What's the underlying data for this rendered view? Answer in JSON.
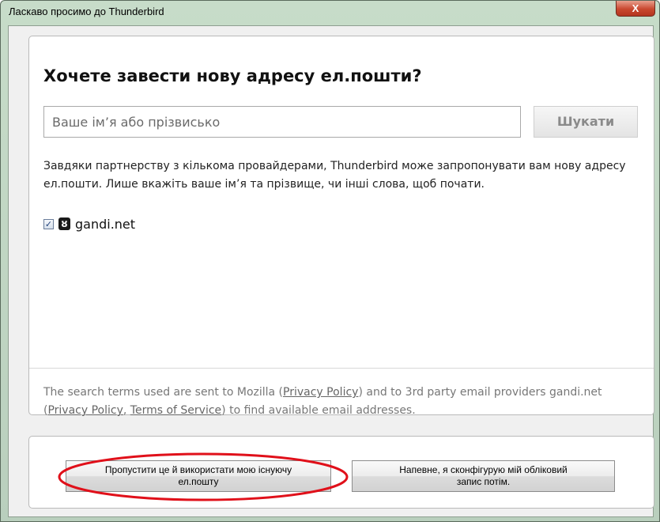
{
  "window": {
    "title": "Ласкаво просимо до Thunderbird",
    "close_label": "X"
  },
  "main": {
    "heading": "Хочете завести нову адресу ел.пошти?",
    "search": {
      "placeholder": "Ваше ім’я або прізвисько",
      "value": "",
      "button_label": "Шукати"
    },
    "description": "Завдяки партнерству з кількома провайдерами, Thunderbird може запропонувати вам нову адресу ел.пошти. Лише вкажіть ваше ім’я та прізвище, чи інші слова, щоб почати.",
    "providers": [
      {
        "label": "gandi.net",
        "checked": true,
        "icon": "gandi-logo-icon",
        "checkmark": "✓",
        "icon_glyph": "ȣ"
      }
    ],
    "privacy": {
      "text_1": "The search terms used are sent to Mozilla (",
      "link_1": "Privacy Policy",
      "text_2": ") and to 3rd party email providers gandi.net (",
      "link_2": "Privacy Policy",
      "text_3": ", ",
      "link_3": "Terms of Service",
      "text_4": ") to find available email addresses."
    }
  },
  "footer": {
    "skip_line1": "Пропустити це й використати мою існуючу",
    "skip_line2": "ел.пошту",
    "later_line1": "Напевне, я сконфігурую мій обліковий",
    "later_line2": "запис потім."
  },
  "colors": {
    "window_frame": "#c7dcc9",
    "close_button": "#c9482f",
    "annotation_ellipse": "#e0101a"
  }
}
